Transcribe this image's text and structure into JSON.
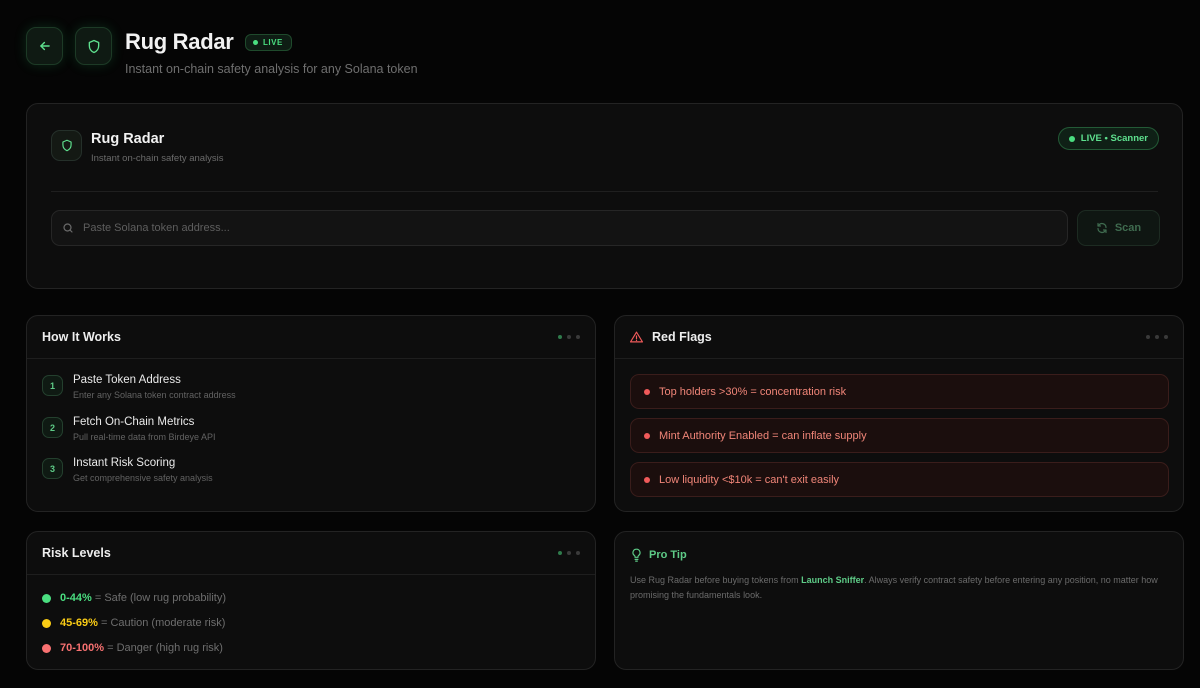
{
  "header": {
    "title": "Rug Radar",
    "live_label": "LIVE",
    "subtitle": "Instant on-chain safety analysis for any Solana token"
  },
  "scanner": {
    "title": "Rug Radar",
    "subtitle": "Instant on-chain safety analysis",
    "status_badge": "LIVE • Scanner",
    "search_placeholder": "Paste Solana token address...",
    "search_value": "",
    "scan_label": "Scan"
  },
  "how_it_works": {
    "title": "How It Works",
    "steps": [
      {
        "num": "1",
        "title": "Paste Token Address",
        "desc": "Enter any Solana token contract address"
      },
      {
        "num": "2",
        "title": "Fetch On-Chain Metrics",
        "desc": "Pull real-time data from Birdeye API"
      },
      {
        "num": "3",
        "title": "Instant Risk Scoring",
        "desc": "Get comprehensive safety analysis"
      }
    ]
  },
  "red_flags": {
    "title": "Red Flags",
    "items": [
      "Top holders >30% = concentration risk",
      "Mint Authority Enabled = can inflate supply",
      "Low liquidity <$10k = can't exit easily"
    ]
  },
  "risk_levels": {
    "title": "Risk Levels",
    "levels": [
      {
        "range": "0-44%",
        "desc": "= Safe (low rug probability)",
        "color": "#4ade80"
      },
      {
        "range": "45-69%",
        "desc": "= Caution (moderate risk)",
        "color": "#facc15"
      },
      {
        "range": "70-100%",
        "desc": "= Danger (high rug risk)",
        "color": "#f87171"
      }
    ]
  },
  "pro_tip": {
    "title": "Pro Tip",
    "text_before": "Use Rug Radar before buying tokens from ",
    "highlight": "Launch Sniffer",
    "text_after": ". Always verify contract safety before entering any position, no matter how promising the fundamentals look."
  },
  "colors": {
    "accent": "#4ade80",
    "danger": "#f05a5a",
    "warning": "#facc15",
    "background": "#050505"
  }
}
